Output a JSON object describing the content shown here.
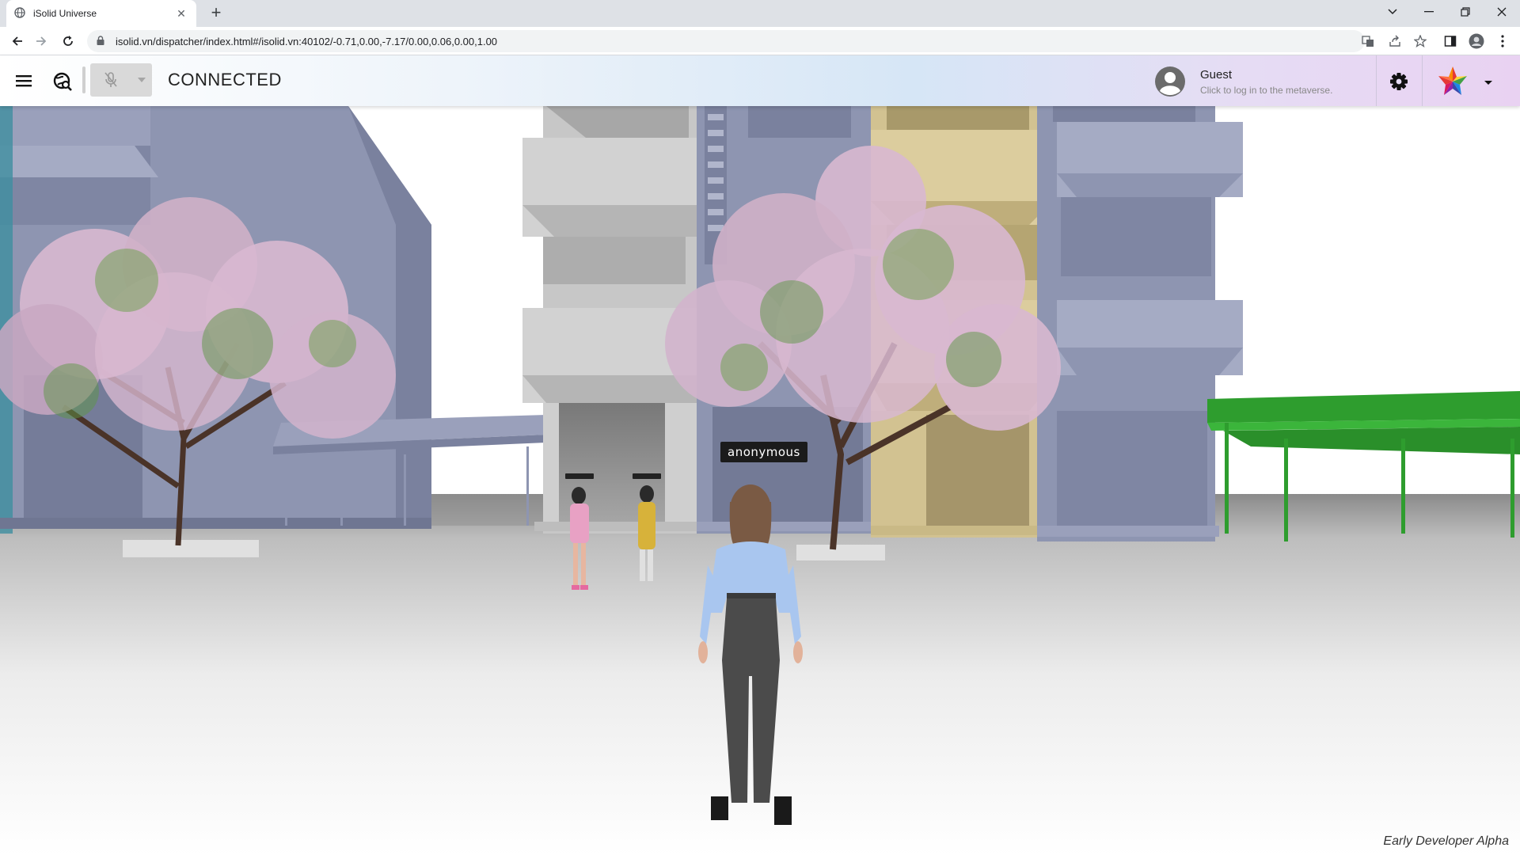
{
  "browser": {
    "tab_title": "iSolid Universe",
    "url": "isolid.vn/dispatcher/index.html#/isolid.vn:40102/-0.71,0.00,-7.17/0.00,0.06,0.00,1.00"
  },
  "header": {
    "status": "CONNECTED",
    "user_name": "Guest",
    "user_subtitle": "Click to log in to the metaverse."
  },
  "scene": {
    "avatar_name": "anonymous",
    "build_label": "Early Developer Alpha"
  },
  "colors": {
    "building_blue": "#8e95b1",
    "building_grey": "#c7c7c7",
    "building_tan": "#d2c291",
    "canopy_green": "#2e9d2e",
    "blossom": "#d8b8d0"
  }
}
